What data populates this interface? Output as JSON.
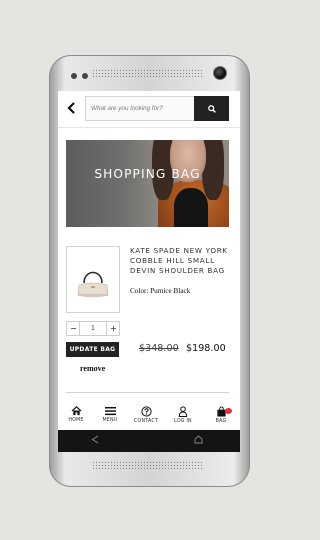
{
  "header": {
    "search_placeholder": "What are you looking for?"
  },
  "banner": {
    "title": "SHOPPING BAG"
  },
  "product": {
    "name": "KATE SPADE NEW YORK COBBLE HILL SMALL DEVIN SHOULDER BAG",
    "color_text": "Color: Pumice Black",
    "quantity": "1",
    "update_label": "UPDATE BAG",
    "original_price": "$348.00",
    "sale_price": "$198.00",
    "remove_label": "remove"
  },
  "tabbar": {
    "home": "HOME",
    "menu": "MENU",
    "contact": "CONTACT",
    "login": "LOG IN",
    "bag": "BAG"
  },
  "colors": {
    "accent": "#222222",
    "badge": "#e8303a"
  }
}
